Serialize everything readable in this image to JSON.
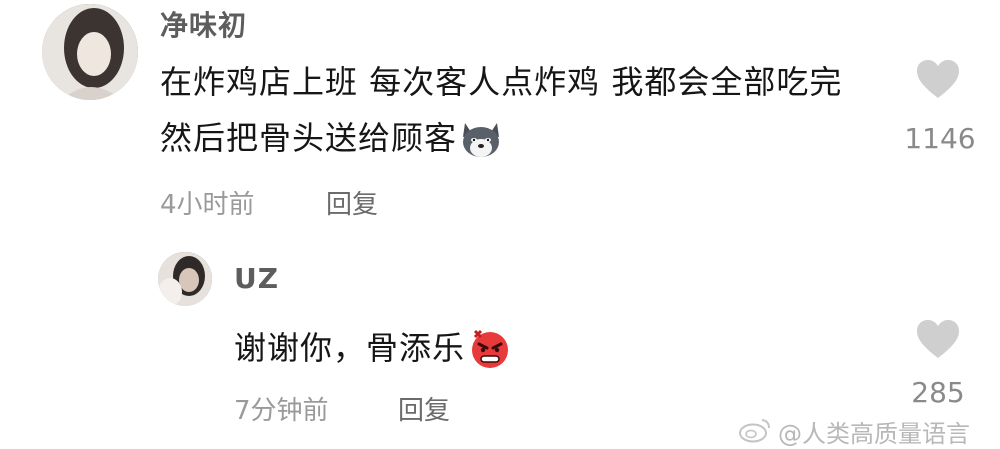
{
  "comments": [
    {
      "username": "净味初",
      "text": "在炸鸡店上班 每次客人点炸鸡 我都会全部吃完 然后把骨头送给顾客",
      "emoji": "husky-dog-emoji",
      "time": "4小时前",
      "reply_label": "回复",
      "likes": "1146"
    },
    {
      "username": "UZ",
      "text": "谢谢你，骨添乐",
      "emoji": "angry-face-emoji",
      "time": "7分钟前",
      "reply_label": "回复",
      "likes": "285"
    }
  ],
  "watermark": {
    "icon": "weibo-icon",
    "text": "@人类高质量语言"
  },
  "colors": {
    "heart": "#cfcfcf",
    "meta_text": "#9a9a9a",
    "username": "#5d5d5d"
  }
}
